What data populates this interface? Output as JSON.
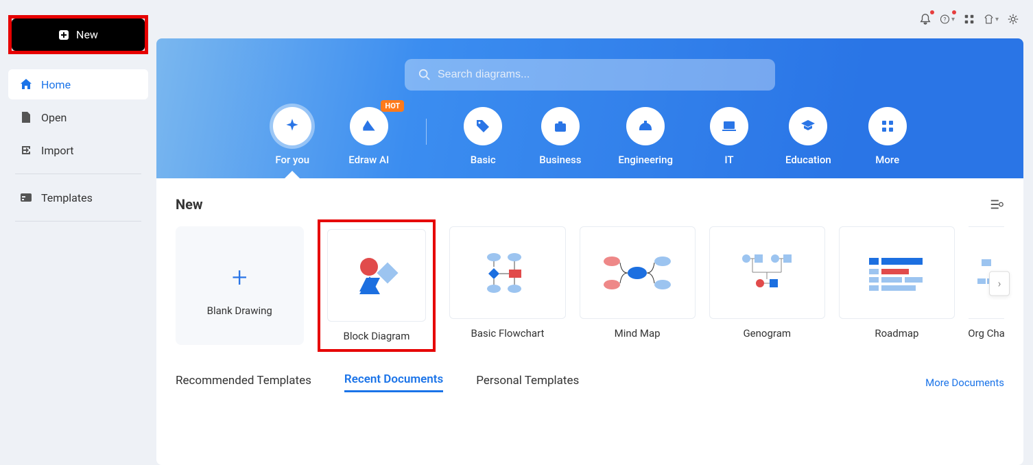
{
  "sidebar": {
    "new_label": "New",
    "items": [
      {
        "label": "Home",
        "icon": "home"
      },
      {
        "label": "Open",
        "icon": "file"
      },
      {
        "label": "Import",
        "icon": "import"
      }
    ],
    "templates_label": "Templates"
  },
  "search": {
    "placeholder": "Search diagrams..."
  },
  "categories": [
    {
      "label": "For you",
      "active": true
    },
    {
      "label": "Edraw AI",
      "badge": "HOT"
    },
    {
      "label": "Basic"
    },
    {
      "label": "Business"
    },
    {
      "label": "Engineering"
    },
    {
      "label": "IT"
    },
    {
      "label": "Education"
    },
    {
      "label": "More"
    }
  ],
  "new_section": {
    "title": "New",
    "blank_label": "Blank Drawing",
    "templates": [
      {
        "label": "Block Diagram",
        "highlighted": true
      },
      {
        "label": "Basic Flowchart"
      },
      {
        "label": "Mind Map"
      },
      {
        "label": "Genogram"
      },
      {
        "label": "Roadmap"
      },
      {
        "label": "Org Cha"
      }
    ]
  },
  "tabs": [
    {
      "label": "Recommended Templates"
    },
    {
      "label": "Recent Documents",
      "active": true
    },
    {
      "label": "Personal Templates"
    }
  ],
  "more_documents_label": "More Documents"
}
